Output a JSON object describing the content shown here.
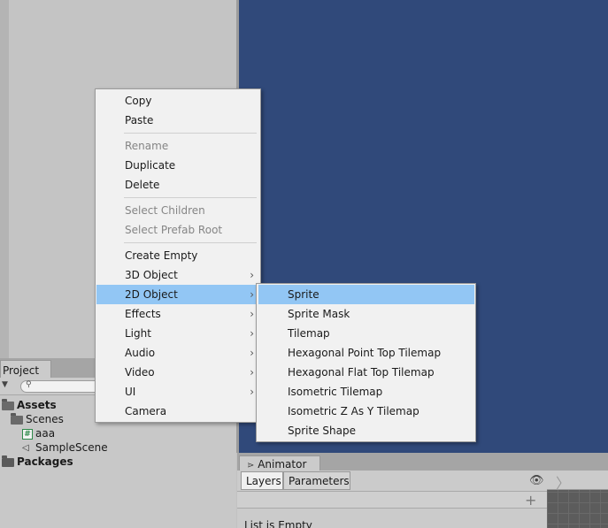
{
  "project": {
    "tab_label": "Project",
    "tree": [
      {
        "label": "Assets",
        "bold": true,
        "type": "folder-open"
      },
      {
        "label": "Scenes",
        "bold": false,
        "type": "folder-open"
      },
      {
        "label": "aaa",
        "bold": false,
        "type": "script"
      },
      {
        "label": "SampleScene",
        "bold": false,
        "type": "unity"
      },
      {
        "label": "Packages",
        "bold": true,
        "type": "folder"
      }
    ]
  },
  "animator": {
    "tab_label": "Animator",
    "layers_tab": "Layers",
    "parameters_tab": "Parameters",
    "empty_text": "List is Empty"
  },
  "context_menu": {
    "items": [
      {
        "label": "Copy",
        "enabled": true
      },
      {
        "label": "Paste",
        "enabled": true
      },
      {
        "label": "Rename",
        "enabled": false
      },
      {
        "label": "Duplicate",
        "enabled": true
      },
      {
        "label": "Delete",
        "enabled": true
      },
      {
        "label": "Select Children",
        "enabled": false
      },
      {
        "label": "Select Prefab Root",
        "enabled": false
      },
      {
        "label": "Create Empty",
        "enabled": true
      },
      {
        "label": "3D Object",
        "enabled": true,
        "submenu": true
      },
      {
        "label": "2D Object",
        "enabled": true,
        "submenu": true,
        "highlighted": true
      },
      {
        "label": "Effects",
        "enabled": true,
        "submenu": true
      },
      {
        "label": "Light",
        "enabled": true,
        "submenu": true
      },
      {
        "label": "Audio",
        "enabled": true,
        "submenu": true
      },
      {
        "label": "Video",
        "enabled": true,
        "submenu": true
      },
      {
        "label": "UI",
        "enabled": true,
        "submenu": true
      },
      {
        "label": "Camera",
        "enabled": true
      }
    ]
  },
  "submenu_2d": {
    "items": [
      {
        "label": "Sprite",
        "highlighted": true
      },
      {
        "label": "Sprite Mask"
      },
      {
        "label": "Tilemap"
      },
      {
        "label": "Hexagonal Point Top Tilemap"
      },
      {
        "label": "Hexagonal Flat Top Tilemap"
      },
      {
        "label": "Isometric Tilemap"
      },
      {
        "label": "Isometric Z As Y Tilemap"
      },
      {
        "label": "Sprite Shape"
      }
    ]
  },
  "colors": {
    "scene_background": "#30497a",
    "menu_highlight": "#92c6f4",
    "menu_background": "#f1f1f1"
  }
}
